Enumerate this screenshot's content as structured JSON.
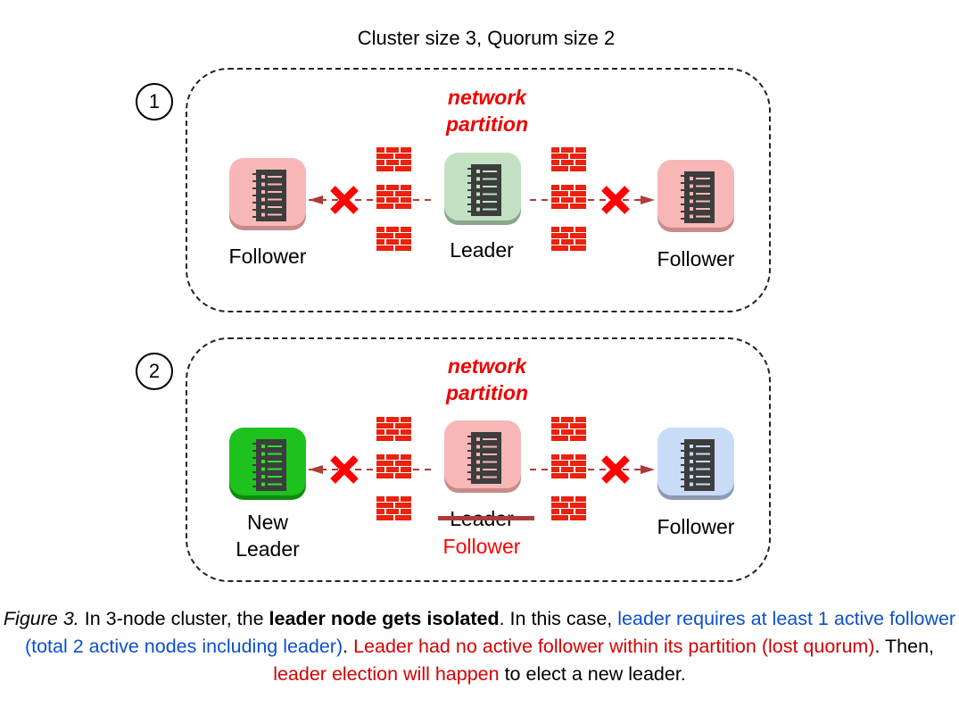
{
  "title": "Cluster size 3, Quorum size 2",
  "panels": [
    {
      "number": "1",
      "partition_label": [
        "network",
        "partition"
      ],
      "nodes": [
        {
          "role": "follower",
          "label": "Follower",
          "fill": "#f7b7b7",
          "shade": "#c98a8a",
          "accent": "#f7b7b7"
        },
        {
          "role": "leader",
          "label": "Leader",
          "fill": "#c3e0c3",
          "shade": "#8aa68a",
          "accent": "#c3e0c3"
        },
        {
          "role": "follower",
          "label": "Follower",
          "fill": "#f7b7b7",
          "shade": "#c98a8a",
          "accent": "#f7b7b7"
        }
      ]
    },
    {
      "number": "2",
      "partition_label": [
        "network",
        "partition"
      ],
      "nodes": [
        {
          "role": "new-leader",
          "label_lines": [
            "New",
            "Leader"
          ],
          "fill": "#1ec21e",
          "shade": "#0e8a0e",
          "accent": "#2fe22f"
        },
        {
          "role": "demoted-leader",
          "old_label": "Leader",
          "new_label": "Follower",
          "fill": "#f7b7b7",
          "shade": "#c98a8a",
          "accent": "#f7b7b7"
        },
        {
          "role": "follower",
          "label": "Follower",
          "fill": "#c9dcf7",
          "shade": "#8b9bb3",
          "accent": "#c9dcf7"
        }
      ]
    }
  ],
  "colors": {
    "brick": "#e8230f",
    "cross": "#ff0000",
    "arrow": "#b03a3a",
    "partition_text": "#ee0000",
    "caption_blue": "#0b4fcc",
    "caption_red": "#d50000"
  },
  "caption": {
    "lead_italic": "Figure 3.",
    "part1": " In 3-node cluster, the ",
    "bold": "leader node gets isolated",
    "part2": ". In this case, ",
    "blue": "leader requires at least 1 active follower (total 2 active nodes including leader)",
    "part3": ". ",
    "red1": "Leader had no active follower within its partition (lost quorum)",
    "part4": ". Then, ",
    "red2": "leader election will happen",
    "part5": " to elect a new leader."
  }
}
